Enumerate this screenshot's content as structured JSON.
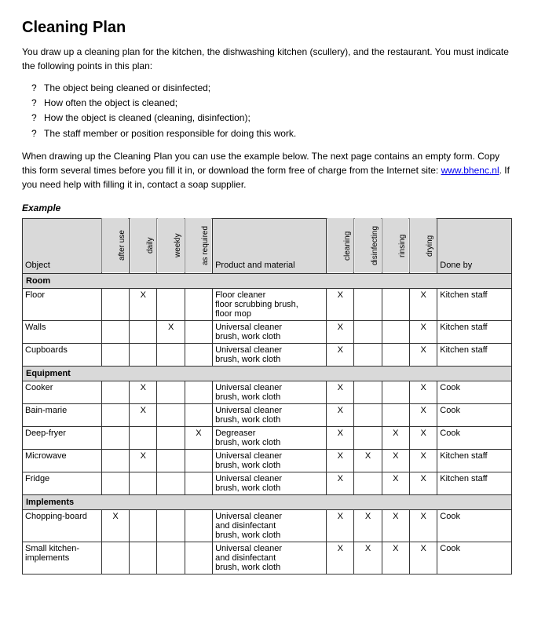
{
  "title": "Cleaning Plan",
  "intro": "You draw up a cleaning plan for the kitchen, the dishwashing kitchen (scullery), and the restaurant. You must indicate the following points in this plan:",
  "bullets": [
    "The object being cleaned or disinfected;",
    "How often the object is cleaned;",
    "How the object is cleaned (cleaning, disinfection);",
    "The staff member or position responsible for doing this work."
  ],
  "note": "When drawing up the Cleaning Plan you can use the example below. The next page contains an empty form. Copy this form several times before you fill it in, or download the form free of charge from the Internet site: www.bhenc.nl. If you need help with filling it in, contact a soap supplier.",
  "note_link": "www.bhenc.nl",
  "example_label": "Example",
  "headers": {
    "object": "Object",
    "after_use": "after use",
    "daily": "daily",
    "weekly": "weekly",
    "as_required": "as required",
    "product": "Product and material",
    "cleaning": "cleaning",
    "disinfecting": "disinfecting",
    "rinsing": "rinsing",
    "drying": "drying",
    "done_by": "Done by"
  },
  "sections": [
    {
      "name": "Room",
      "rows": [
        {
          "object": "Floor",
          "after_use": "",
          "daily": "X",
          "weekly": "",
          "as_required": "",
          "product": "Floor cleaner\nfloor scrubbing brush,\nfloor mop",
          "cleaning": "X",
          "disinfecting": "",
          "rinsing": "",
          "drying": "X",
          "done_by": "Kitchen staff"
        },
        {
          "object": "Walls",
          "after_use": "",
          "daily": "",
          "weekly": "X",
          "as_required": "",
          "product": "Universal cleaner\nbrush, work cloth",
          "cleaning": "X",
          "disinfecting": "",
          "rinsing": "",
          "drying": "X",
          "done_by": "Kitchen staff"
        },
        {
          "object": "Cupboards",
          "after_use": "",
          "daily": "",
          "weekly": "",
          "as_required": "",
          "product": "Universal cleaner\nbrush, work cloth",
          "cleaning": "X",
          "disinfecting": "",
          "rinsing": "",
          "drying": "X",
          "done_by": "Kitchen staff"
        }
      ]
    },
    {
      "name": "Equipment",
      "rows": [
        {
          "object": "Cooker",
          "after_use": "",
          "daily": "X",
          "weekly": "",
          "as_required": "",
          "product": "Universal cleaner\nbrush, work cloth",
          "cleaning": "X",
          "disinfecting": "",
          "rinsing": "",
          "drying": "X",
          "done_by": "Cook"
        },
        {
          "object": "Bain-marie",
          "after_use": "",
          "daily": "X",
          "weekly": "",
          "as_required": "",
          "product": "Universal cleaner\nbrush, work cloth",
          "cleaning": "X",
          "disinfecting": "",
          "rinsing": "",
          "drying": "X",
          "done_by": "Cook"
        },
        {
          "object": "Deep-fryer",
          "after_use": "",
          "daily": "",
          "weekly": "",
          "as_required": "X",
          "product": "Degreaser\nbrush, work cloth",
          "cleaning": "X",
          "disinfecting": "",
          "rinsing": "X",
          "drying": "X",
          "done_by": "Cook"
        },
        {
          "object": "Microwave",
          "after_use": "",
          "daily": "X",
          "weekly": "",
          "as_required": "",
          "product": "Universal cleaner\nbrush, work cloth",
          "cleaning": "X",
          "disinfecting": "X",
          "rinsing": "X",
          "drying": "X",
          "done_by": "Kitchen staff"
        },
        {
          "object": "Fridge",
          "after_use": "",
          "daily": "",
          "weekly": "",
          "as_required": "",
          "product": "Universal cleaner\nbrush, work cloth",
          "cleaning": "X",
          "disinfecting": "",
          "rinsing": "X",
          "drying": "X",
          "done_by": "Kitchen staff"
        }
      ]
    },
    {
      "name": "Implements",
      "rows": [
        {
          "object": "Chopping-board",
          "after_use": "X",
          "daily": "",
          "weekly": "",
          "as_required": "",
          "product": "Universal cleaner\nand disinfectant\nbrush, work cloth",
          "cleaning": "X",
          "disinfecting": "X",
          "rinsing": "X",
          "drying": "X",
          "done_by": "Cook"
        },
        {
          "object": "Small kitchen-implements",
          "after_use": "",
          "daily": "",
          "weekly": "",
          "as_required": "",
          "product": "Universal cleaner\nand disinfectant\nbrush, work cloth",
          "cleaning": "X",
          "disinfecting": "X",
          "rinsing": "X",
          "drying": "X",
          "done_by": "Cook"
        }
      ]
    }
  ]
}
